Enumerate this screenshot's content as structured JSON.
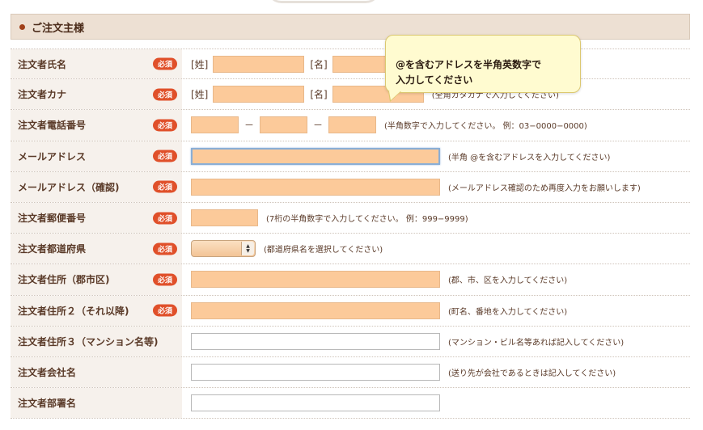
{
  "section": {
    "title": "ご注文主様"
  },
  "required_badge": "必須",
  "tooltip": {
    "line1": "@を含むアドレスを半角英数字で",
    "line2": "入力してください"
  },
  "rows": {
    "name": {
      "label": "注文者氏名",
      "sei": "[姓]",
      "mei": "[名]"
    },
    "kana": {
      "label": "注文者カナ",
      "sei": "[姓]",
      "mei": "[名]",
      "hint": "(全角カタカナで入力してください)"
    },
    "tel": {
      "label": "注文者電話番号",
      "dash": "－",
      "hint": "(半角数字で入力してください。 例：03−0000−0000)"
    },
    "email": {
      "label": "メールアドレス",
      "hint": "(半角 @を含むアドレスを入力してください)"
    },
    "email_confirm": {
      "label": "メールアドレス（確認)",
      "hint": "(メールアドレス確認のため再度入力をお願いします)"
    },
    "zip": {
      "label": "注文者郵便番号",
      "hint": "(7桁の半角数字で入力してください。 例：999−9999)"
    },
    "pref": {
      "label": "注文者都道府県",
      "hint": "(都道府県名を選択してください)"
    },
    "addr1": {
      "label": "注文者住所（郡市区)",
      "hint": "(郡、市、区を入力してください)"
    },
    "addr2": {
      "label": "注文者住所２（それ以降)",
      "hint": "(町名、番地を入力してください)"
    },
    "addr3": {
      "label": "注文者住所３（マンション名等)",
      "hint": "(マンション・ビル名等あれば記入してください)"
    },
    "company": {
      "label": "注文者会社名",
      "hint": "(送り先が会社であるときは記入してください)"
    },
    "dept": {
      "label": "注文者部署名"
    }
  }
}
